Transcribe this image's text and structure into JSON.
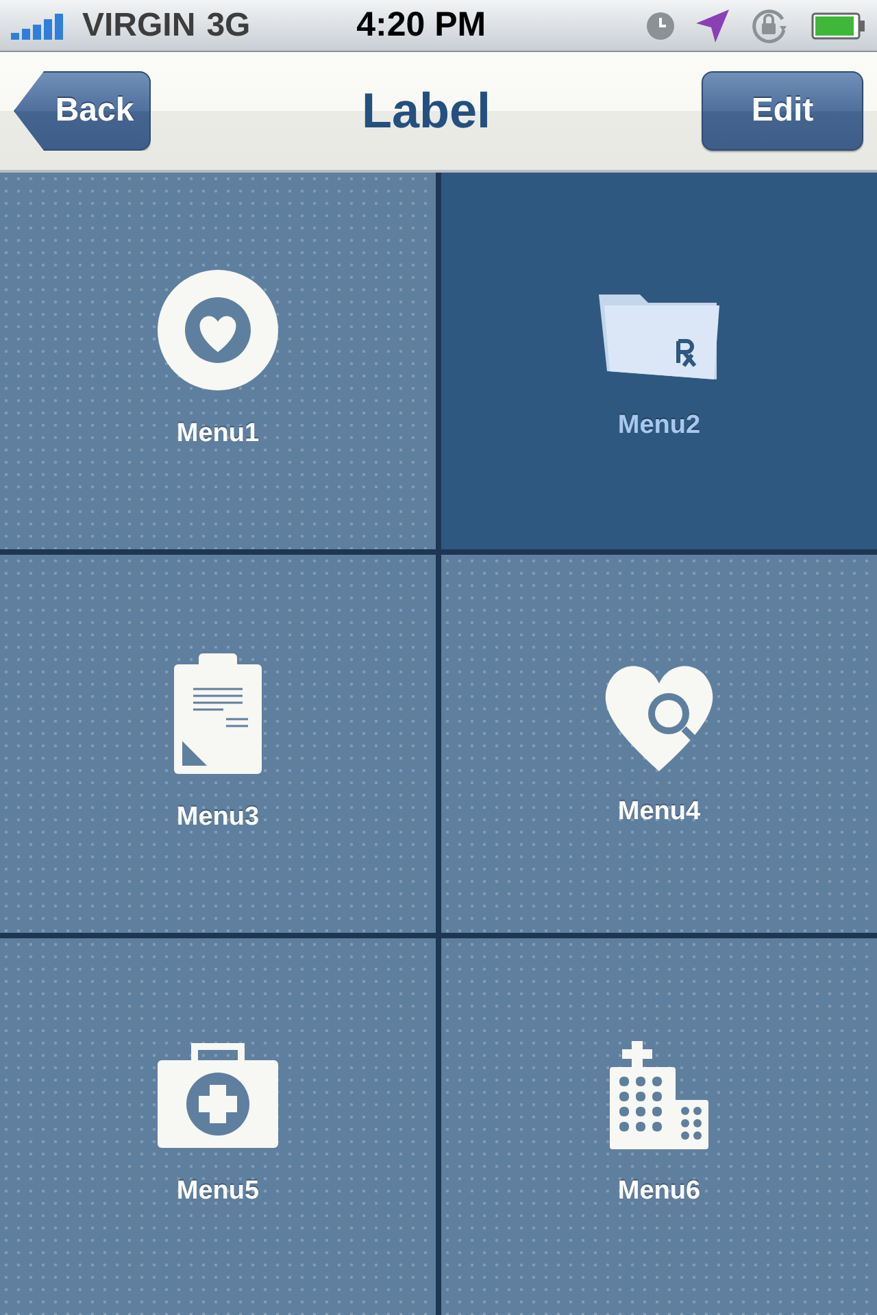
{
  "status_bar": {
    "carrier": "VIRGIN",
    "network": "3G",
    "time": "4:20 PM"
  },
  "nav_bar": {
    "back": "Back",
    "title": "Label",
    "edit": "Edit"
  },
  "tiles": [
    {
      "label": "Menu1",
      "kind": "heart-circle",
      "selected": false
    },
    {
      "label": "Menu2",
      "kind": "folder",
      "selected": true
    },
    {
      "label": "Menu3",
      "kind": "clipboard",
      "selected": false
    },
    {
      "label": "Menu4",
      "kind": "heart-search",
      "selected": false
    },
    {
      "label": "Menu5",
      "kind": "first-aid",
      "selected": false
    },
    {
      "label": "Menu6",
      "kind": "hospital",
      "selected": false
    }
  ]
}
